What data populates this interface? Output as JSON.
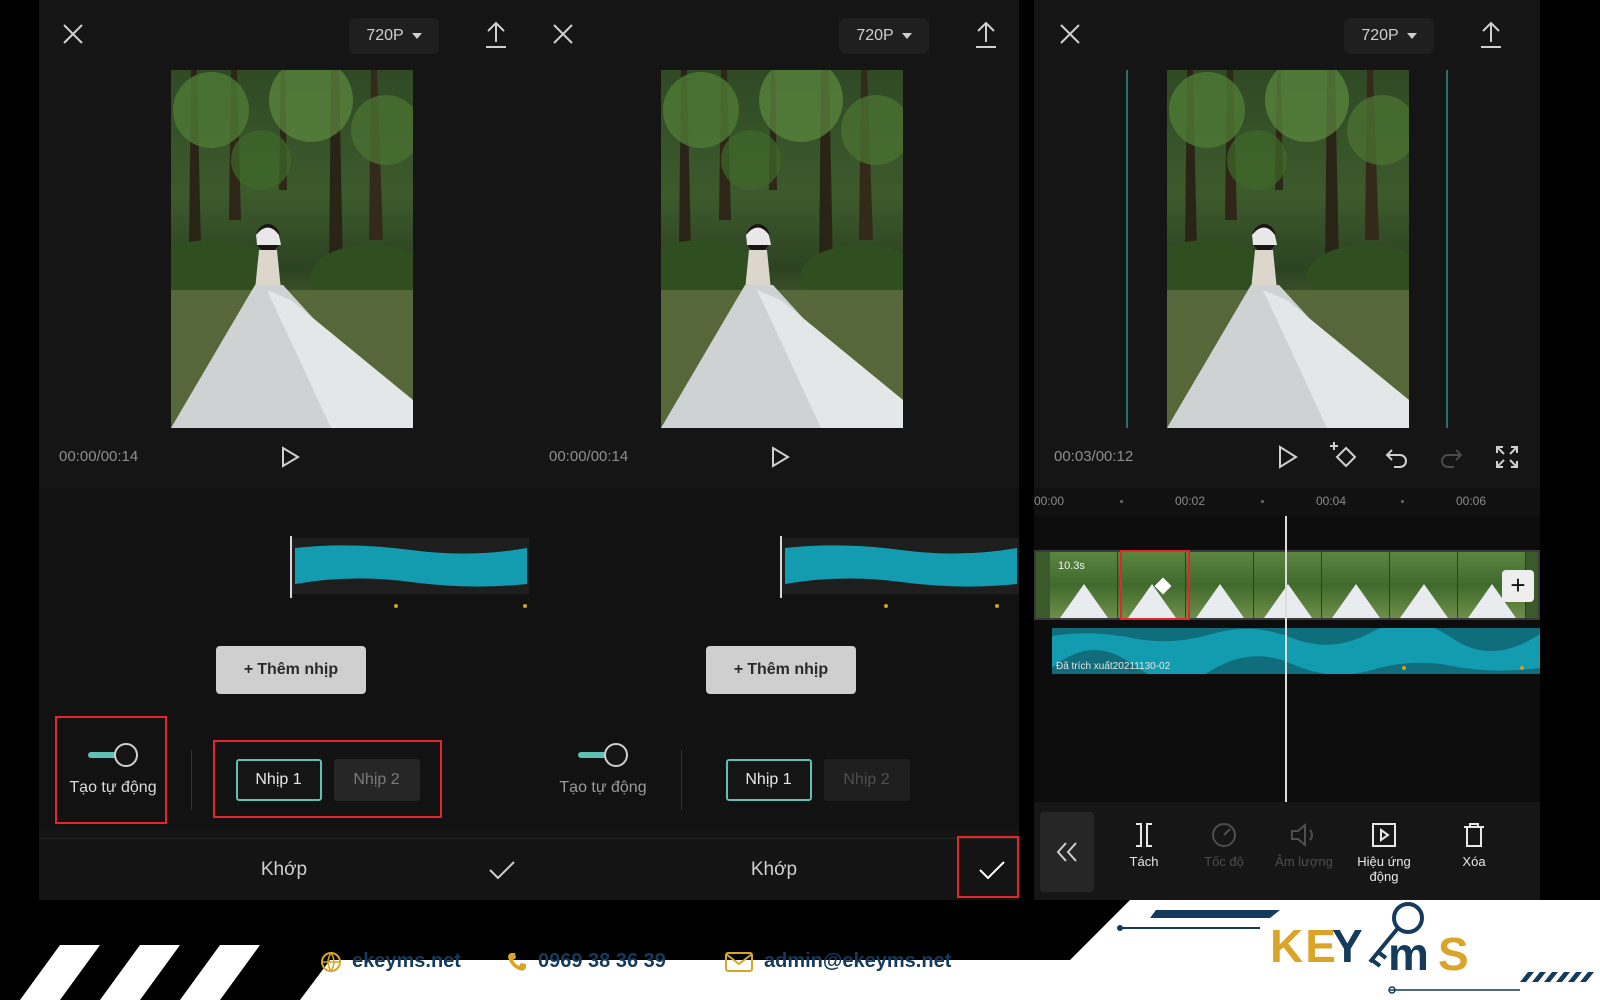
{
  "panels": [
    {
      "resolution": "720P",
      "timecode": "00:00/00:14",
      "add_beat_label": "Thêm nhịp",
      "auto_label": "Tạo tự động",
      "beat_tabs": [
        "Nhịp 1",
        "Nhịp 2"
      ],
      "bottom_title": "Khớp"
    },
    {
      "resolution": "720P",
      "timecode": "00:00/00:14",
      "add_beat_label": "Thêm nhịp",
      "auto_label": "Tạo tự động",
      "beat_tabs": [
        "Nhịp 1",
        "Nhịp 2"
      ],
      "bottom_title": "Khớp"
    },
    {
      "resolution": "720P",
      "timecode": "00:03/00:12",
      "ruler": [
        "00:00",
        "00:02",
        "00:04",
        "00:06"
      ],
      "clip_duration": "10.3s",
      "audio_clip_name": "Đã trích xuất20211130-02",
      "tools": [
        {
          "icon": "split-icon",
          "label": "Tách",
          "enabled": true
        },
        {
          "icon": "speed-icon",
          "label": "Tốc độ",
          "enabled": false
        },
        {
          "icon": "volume-icon",
          "label": "Âm lượng",
          "enabled": false
        },
        {
          "icon": "animation-icon",
          "label": "Hiệu ứng động",
          "enabled": true
        },
        {
          "icon": "delete-icon",
          "label": "Xóa",
          "enabled": true
        }
      ]
    }
  ],
  "footer": {
    "website": "ekeyms.net",
    "phone": "0969 38 36 39",
    "email": "admin@ekeyms.net",
    "logo_text": "KEYMS"
  },
  "colors": {
    "accent_teal": "#5fc0b4",
    "waveform": "#139cb0",
    "highlight_red": "#e3262b",
    "brand_navy": "#143a5c",
    "brand_gold": "#d9a427"
  }
}
